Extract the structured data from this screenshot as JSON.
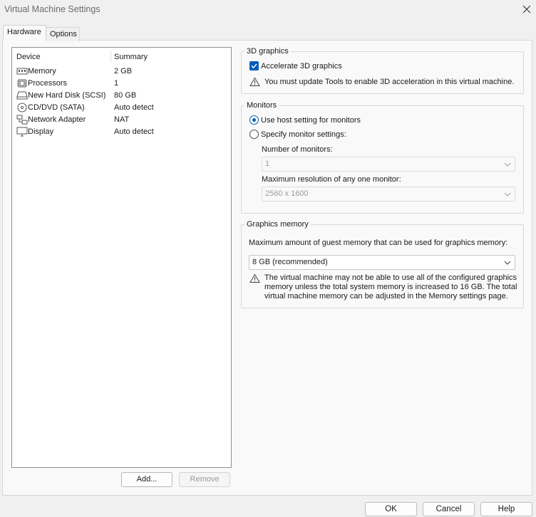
{
  "window": {
    "title": "Virtual Machine Settings"
  },
  "tabs": {
    "hardware": "Hardware",
    "options": "Options"
  },
  "device_list": {
    "header_device": "Device",
    "header_summary": "Summary",
    "rows": [
      {
        "icon": "memory-icon",
        "device": "Memory",
        "summary": "2 GB"
      },
      {
        "icon": "processor-icon",
        "device": "Processors",
        "summary": "1"
      },
      {
        "icon": "hard-disk-icon",
        "device": "New Hard Disk (SCSI)",
        "summary": "80 GB"
      },
      {
        "icon": "cd-dvd-icon",
        "device": "CD/DVD (SATA)",
        "summary": "Auto detect"
      },
      {
        "icon": "network-adapter-icon",
        "device": "Network Adapter",
        "summary": "NAT"
      },
      {
        "icon": "display-icon",
        "device": "Display",
        "summary": "Auto detect"
      }
    ],
    "add_button": "Add...",
    "remove_button": "Remove"
  },
  "graphics_3d": {
    "title": "3D graphics",
    "accelerate_label": "Accelerate 3D graphics",
    "accelerate_checked": true,
    "warning": "You must update Tools to enable 3D acceleration in this virtual machine."
  },
  "monitors": {
    "title": "Monitors",
    "use_host_label": "Use host setting for monitors",
    "specify_label": "Specify monitor settings:",
    "selected": "use_host",
    "number_label": "Number of monitors:",
    "number_value": "1",
    "max_res_label": "Maximum resolution of any one monitor:",
    "max_res_value": "2560 x 1600"
  },
  "graphics_memory": {
    "title": "Graphics memory",
    "description": "Maximum amount of guest memory that can be used for graphics memory:",
    "value": "8 GB (recommended)",
    "warning_line1": "The virtual machine may not be able to use all of the configured graphics",
    "warning_line2": "memory unless the total system memory is increased to 16 GB. The total",
    "warning_line3": "virtual machine memory can be adjusted in the Memory settings page."
  },
  "footer": {
    "ok": "OK",
    "cancel": "Cancel",
    "help": "Help"
  },
  "colors": {
    "accent": "#005fb8",
    "window_bg": "#f0f0f0",
    "panel_bg": "#f9f9f9"
  }
}
